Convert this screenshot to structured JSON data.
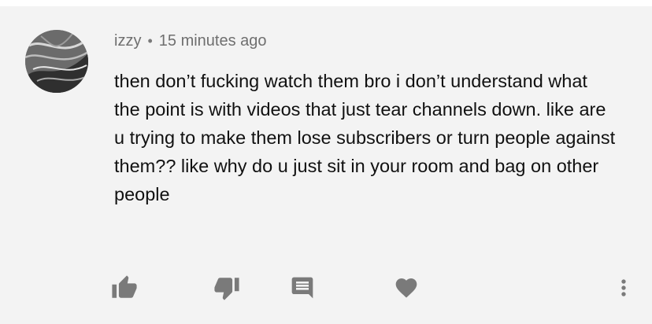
{
  "comment": {
    "author": "izzy",
    "separator": "•",
    "timestamp": "15 minutes ago",
    "text": "then don’t fucking watch them bro i don’t understand what the point is with videos that just tear channels down. like are u trying to make them lose subscribers or turn people against them?? like why do u just sit in your room and bag on other people"
  },
  "actions": [
    {
      "icon": "thumbs-up-icon"
    },
    {
      "icon": "thumbs-down-icon"
    },
    {
      "icon": "reply-icon"
    },
    {
      "icon": "heart-icon"
    },
    {
      "icon": "more-vert-icon"
    }
  ],
  "colors": {
    "background": "#f3f3f3",
    "meta_text": "#6f6f6f",
    "body_text": "#111111",
    "icon": "#7a7a7a"
  }
}
